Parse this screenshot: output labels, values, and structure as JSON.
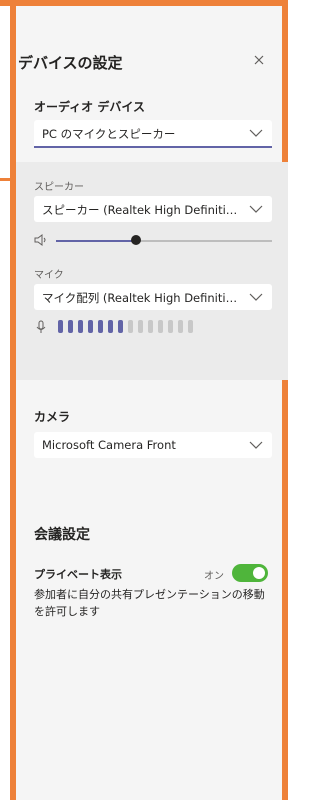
{
  "panel": {
    "title": "デバイスの設定",
    "close_label": "×"
  },
  "audio": {
    "section_label": "オーディオ デバイス",
    "selected": "PC のマイクとスピーカー"
  },
  "speaker": {
    "label": "スピーカー",
    "selected": "スピーカー (Realtek High Definition Aud...",
    "volume_fraction": 0.37
  },
  "mic": {
    "label": "マイク",
    "selected": "マイク配列 (Realtek High Definition A...",
    "level_active": 7,
    "level_total": 14
  },
  "camera": {
    "label": "カメラ",
    "selected": "Microsoft Camera Front"
  },
  "meeting": {
    "title": "会議設定",
    "private_view_label": "プライベート表示",
    "toggle_state_label": "オン",
    "description": "参加者に自分の共有プレゼンテーションの移動を許可します"
  },
  "colors": {
    "accent": "#6264a7",
    "toggle_on": "#4fb53b",
    "frame": "#ee8139"
  }
}
